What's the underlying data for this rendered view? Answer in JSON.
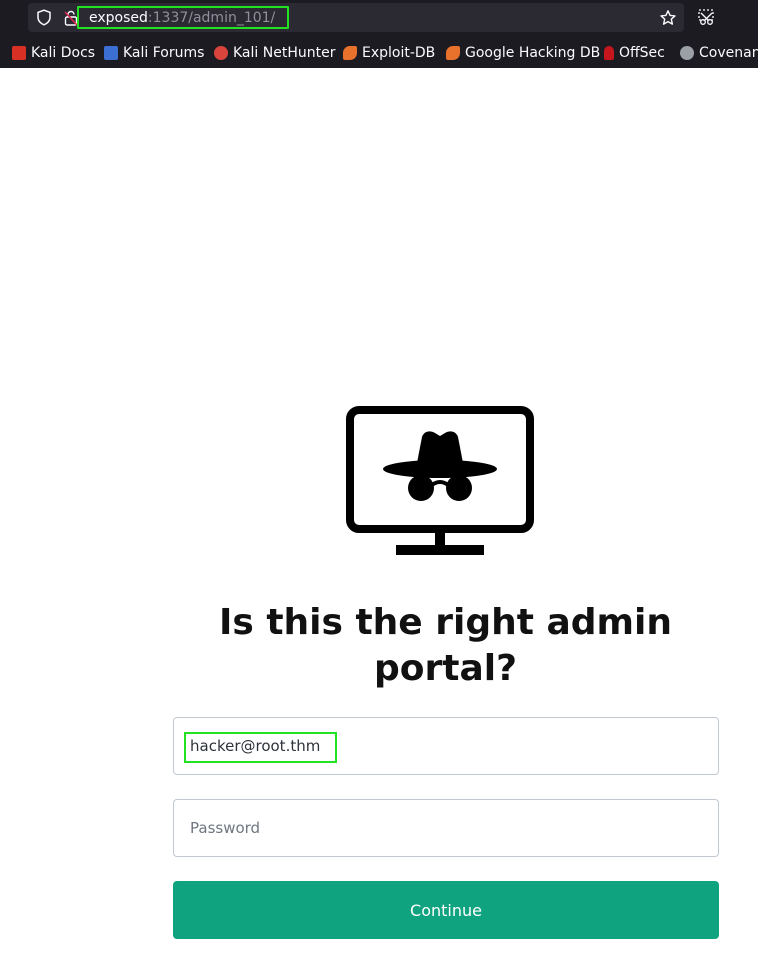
{
  "browser": {
    "url_host": "exposed",
    "url_rest": ":1337/admin_101/",
    "bookmarks": [
      {
        "label": "Kali Docs",
        "icon": "kali-docs-icon",
        "color": "#d93025"
      },
      {
        "label": "Kali Forums",
        "icon": "kali-forums-icon",
        "color": "#3b6fd4"
      },
      {
        "label": "Kali NetHunter",
        "icon": "kali-nethunter-icon",
        "color": "#d9443c"
      },
      {
        "label": "Exploit-DB",
        "icon": "exploit-db-icon",
        "color": "#e8712c"
      },
      {
        "label": "Google Hacking DB",
        "icon": "ghdb-icon",
        "color": "#e8712c"
      },
      {
        "label": "OffSec",
        "icon": "offsec-icon",
        "color": "#c4161c"
      },
      {
        "label": "Covenant",
        "icon": "covenant-icon",
        "color": "#9aa0a6"
      }
    ],
    "highlight_color": "#22e322"
  },
  "page": {
    "title": "Is this the right admin portal?",
    "email_value": "hacker@root.thm",
    "password_placeholder": "Password",
    "continue_label": "Continue",
    "button_color": "#10a37f"
  }
}
